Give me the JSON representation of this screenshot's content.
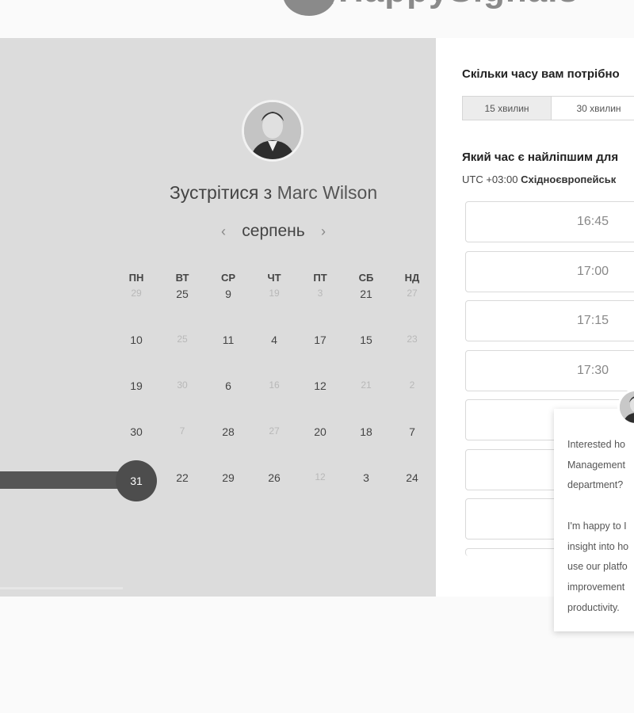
{
  "header": {
    "logo_text": "HappySignals"
  },
  "left": {
    "meet_prefix": "Зустрітися з",
    "host_name": "Marc Wilson",
    "month": "серпень",
    "prev_arrow": "‹",
    "next_arrow": "›",
    "weekdays": [
      "ПН",
      "ВТ",
      "СР",
      "ЧТ",
      "ПТ",
      "СБ",
      "НД"
    ],
    "weeks": [
      [
        {
          "d": "29",
          "dim": true
        },
        {
          "d": "25",
          "dim": false
        },
        {
          "d": "9",
          "dim": false
        },
        {
          "d": "19",
          "dim": true
        },
        {
          "d": "3",
          "dim": true
        },
        {
          "d": "21",
          "dim": false
        },
        {
          "d": "27",
          "dim": true
        }
      ],
      [
        {
          "d": "10",
          "dim": false
        },
        {
          "d": "25",
          "dim": true
        },
        {
          "d": "11",
          "dim": false
        },
        {
          "d": "4",
          "dim": false
        },
        {
          "d": "17",
          "dim": false
        },
        {
          "d": "15",
          "dim": false
        },
        {
          "d": "23",
          "dim": true
        }
      ],
      [
        {
          "d": "19",
          "dim": false
        },
        {
          "d": "30",
          "dim": true
        },
        {
          "d": "6",
          "dim": false
        },
        {
          "d": "16",
          "dim": true
        },
        {
          "d": "12",
          "dim": false
        },
        {
          "d": "21",
          "dim": true
        },
        {
          "d": "2",
          "dim": true
        }
      ],
      [
        {
          "d": "30",
          "dim": false
        },
        {
          "d": "7",
          "dim": true
        },
        {
          "d": "28",
          "dim": false
        },
        {
          "d": "27",
          "dim": true
        },
        {
          "d": "20",
          "dim": false
        },
        {
          "d": "18",
          "dim": false
        },
        {
          "d": "7",
          "dim": false
        }
      ],
      [
        {
          "d": "31",
          "dim": false,
          "selected": true
        },
        {
          "d": "22",
          "dim": false
        },
        {
          "d": "29",
          "dim": false
        },
        {
          "d": "26",
          "dim": false
        },
        {
          "d": "12",
          "dim": true
        },
        {
          "d": "3",
          "dim": false
        },
        {
          "d": "24",
          "dim": false
        }
      ]
    ]
  },
  "right": {
    "duration_question": "Скільки часу вам потрібно",
    "durations": [
      "15 хвилин",
      "30 хвилин"
    ],
    "time_question": "Який час є найліпшим для",
    "tz_offset": "UTC +03:00",
    "tz_name": "Східноєвропейськ",
    "slots": [
      "16:45",
      "17:00",
      "17:15",
      "17:30",
      "",
      "",
      "",
      ""
    ]
  },
  "chat": {
    "lines": [
      "Interested ho",
      "Management",
      "department?",
      "",
      "I'm happy to I",
      "insight into ho",
      "use our platfo",
      "improvement",
      "productivity."
    ]
  },
  "colors": {
    "panel_bg": "#dcdcdc",
    "selected": "#4d4d4d"
  }
}
